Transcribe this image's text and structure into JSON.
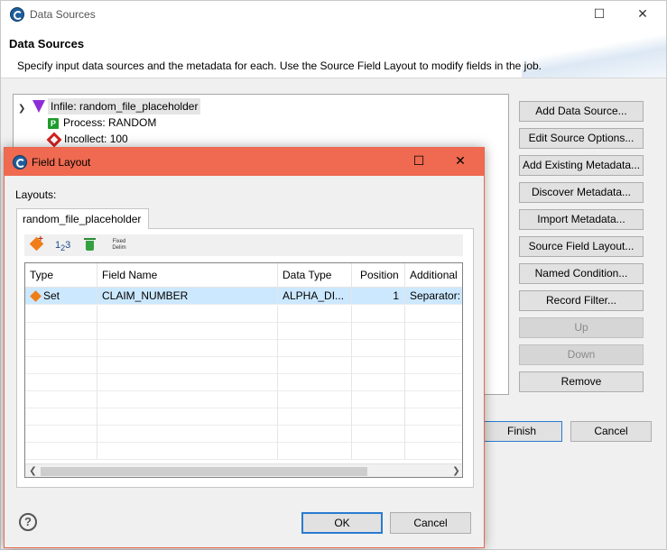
{
  "main_window": {
    "title": "Data Sources",
    "heading": "Data Sources",
    "description": "Specify input data sources and the metadata for each. Use the Source Field Layout to modify fields in the job.",
    "tree": {
      "root_label": "Infile: random_file_placeholder",
      "children": [
        {
          "label": "Process: RANDOM",
          "icon": "process-p-icon"
        },
        {
          "label": "Incollect: 100",
          "icon": "red-diamond-icon"
        }
      ]
    },
    "side_buttons": [
      {
        "label": "Add Data Source...",
        "enabled": true
      },
      {
        "label": "Edit Source Options...",
        "enabled": true
      },
      {
        "label": "Add Existing Metadata...",
        "enabled": true
      },
      {
        "label": "Discover Metadata...",
        "enabled": true
      },
      {
        "label": "Import Metadata...",
        "enabled": true
      },
      {
        "label": "Source Field Layout...",
        "enabled": true
      },
      {
        "label": "Named Condition...",
        "enabled": true
      },
      {
        "label": "Record Filter...",
        "enabled": true
      },
      {
        "label": "Up",
        "enabled": false
      },
      {
        "label": "Down",
        "enabled": false
      },
      {
        "label": "Remove",
        "enabled": true
      }
    ],
    "finish_label": "Finish",
    "cancel_label": "Cancel"
  },
  "dialog": {
    "title": "Field Layout",
    "layouts_label": "Layouts:",
    "tab_label": "random_file_placeholder",
    "toolbar": {
      "num_main": "1",
      "num_sub": "2",
      "num_tail": "3",
      "fixed_line1": "Fixed",
      "fixed_line2": "Delim"
    },
    "columns": [
      "Type",
      "Field Name",
      "Data Type",
      "Position",
      "Additional"
    ],
    "rows": [
      {
        "type": "Set",
        "field_name": "CLAIM_NUMBER",
        "data_type": "ALPHA_DI...",
        "position": "1",
        "additional": "Separator: ,",
        "selected": true
      }
    ],
    "ok_label": "OK",
    "cancel_label": "Cancel",
    "help_symbol": "?"
  },
  "colors": {
    "dialog_titlebar": "#ef6a50",
    "selection": "#cce8ff",
    "primary_border": "#2a7bd0"
  }
}
